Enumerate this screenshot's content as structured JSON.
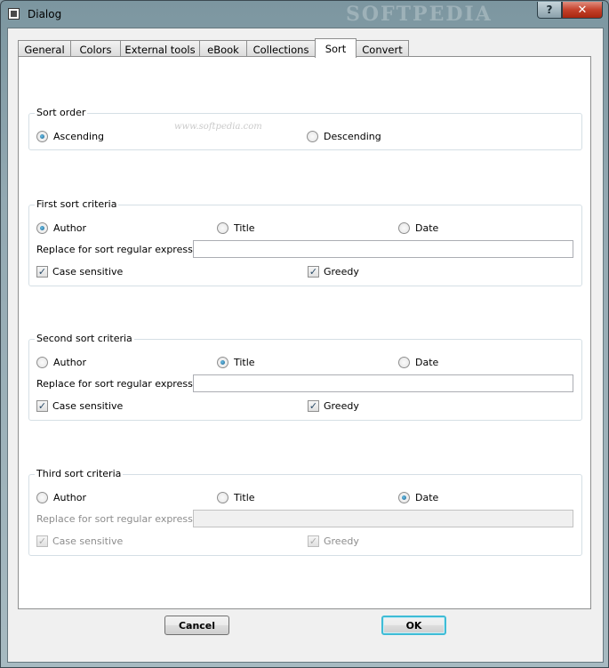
{
  "window": {
    "title": "Dialog",
    "watermark": "SOFTPEDIA",
    "watermark_url": "www.softpedia.com",
    "help_label": "?",
    "close_label": "✕"
  },
  "tabs": [
    {
      "label": "General"
    },
    {
      "label": "Colors"
    },
    {
      "label": "External tools"
    },
    {
      "label": "eBook"
    },
    {
      "label": "Collections"
    },
    {
      "label": "Sort",
      "active": true
    },
    {
      "label": "Convert"
    }
  ],
  "sort_order": {
    "title": "Sort order",
    "ascending": "Ascending",
    "descending": "Descending",
    "selected": "Ascending"
  },
  "criteria": [
    {
      "title": "First sort criteria",
      "author": "Author",
      "title_opt": "Title",
      "date": "Date",
      "selected": "Author",
      "replace_label": "Replace for sort regular expression",
      "replace_value": "",
      "case_sensitive": "Case sensitive",
      "case_checked": true,
      "greedy": "Greedy",
      "greedy_checked": true,
      "enabled": true
    },
    {
      "title": "Second sort criteria",
      "author": "Author",
      "title_opt": "Title",
      "date": "Date",
      "selected": "Title",
      "replace_label": "Replace for sort regular expression",
      "replace_value": "",
      "case_sensitive": "Case sensitive",
      "case_checked": true,
      "greedy": "Greedy",
      "greedy_checked": true,
      "enabled": true
    },
    {
      "title": "Third sort criteria",
      "author": "Author",
      "title_opt": "Title",
      "date": "Date",
      "selected": "Date",
      "replace_label": "Replace for sort regular expression",
      "replace_value": "",
      "case_sensitive": "Case sensitive",
      "case_checked": true,
      "greedy": "Greedy",
      "greedy_checked": true,
      "enabled": false
    }
  ],
  "buttons": {
    "cancel": "Cancel",
    "ok": "OK"
  },
  "colors": {
    "ok_focus": "#3fbcd6",
    "close_red": "#c4412b"
  }
}
